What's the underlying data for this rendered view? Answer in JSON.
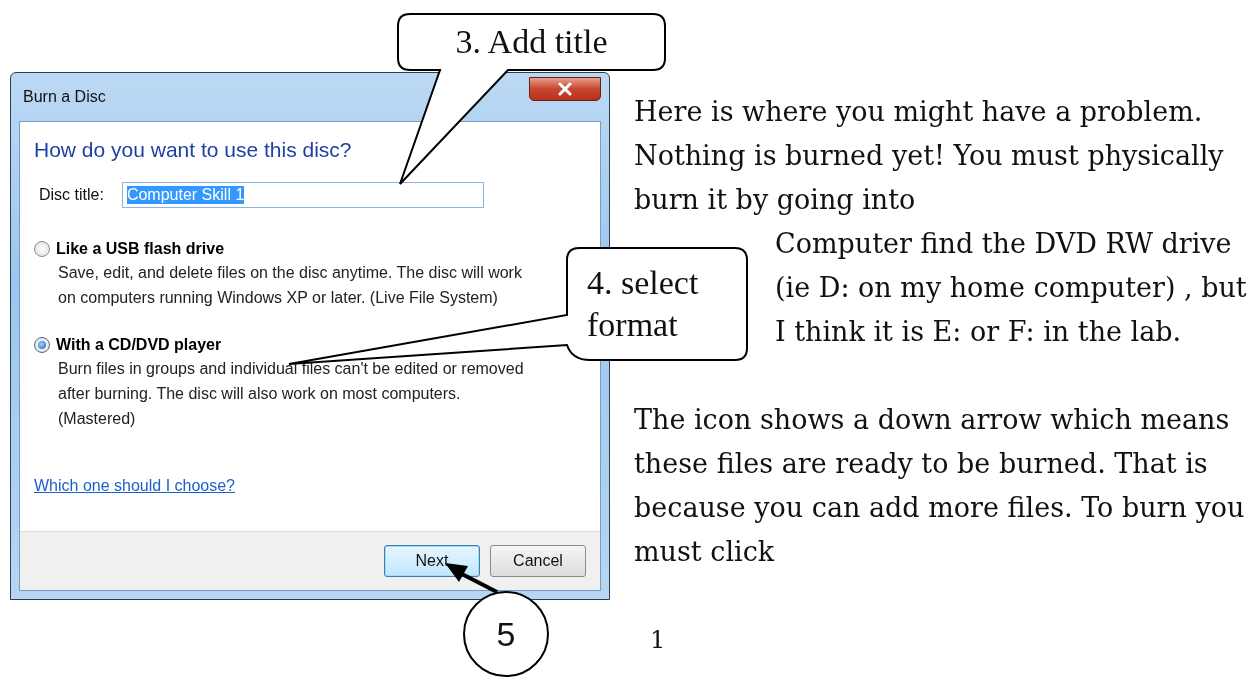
{
  "window": {
    "title": "Burn a Disc"
  },
  "dialog": {
    "heading": "How do you want to use this disc?",
    "disc_title": {
      "label": "Disc title:",
      "value": "Computer Skill 1"
    },
    "options": [
      {
        "label": "Like a USB flash drive",
        "description": "Save, edit, and delete files on the disc anytime. The disc will work on computers running Windows XP or later. (Live File System)",
        "selected": false
      },
      {
        "label": "With a CD/DVD player",
        "description": "Burn files in groups and individual files can't be edited or removed after burning. The disc will also work on most computers. (Mastered)",
        "selected": true
      }
    ],
    "help_link": "Which one should I choose?",
    "buttons": [
      {
        "label": "Next",
        "default": true
      },
      {
        "label": "Cancel",
        "default": false
      }
    ]
  },
  "callouts": [
    {
      "kind": "bubble",
      "text": "3. Add title"
    },
    {
      "kind": "bubble",
      "text": "4. select format"
    },
    {
      "kind": "circle",
      "text": "5"
    }
  ],
  "body_text": [
    {
      "kind": "full",
      "text": "Here is where you might have a problem.  Nothing is burned yet!  You must physically burn it by going into"
    },
    {
      "kind": "indented",
      "text": "Computer find the DVD RW drive (ie D: on my home computer) , but I think it is E: or F:  in the lab."
    },
    {
      "kind": "full",
      "text": "The icon shows a down arrow which means these files are ready to be burned.  That is because you can add more files.  To burn you must click"
    }
  ],
  "page_number": "1"
}
